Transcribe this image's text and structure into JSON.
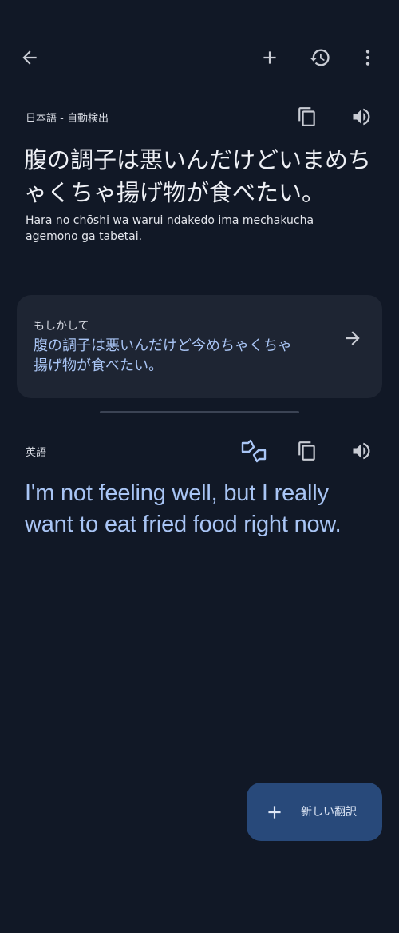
{
  "toolbar": {
    "back_icon": "arrow-back-icon",
    "add_icon": "plus-icon",
    "history_icon": "history-icon",
    "more_icon": "more-vert-icon"
  },
  "source": {
    "language_label": "日本語 - 自動検出",
    "text": "腹の調子は悪いんだけどいまめちゃくちゃ揚げ物が食べたい。",
    "transliteration": "Hara no chōshi wa warui ndakedo ima mechakucha agemono ga tabetai.",
    "copy_icon": "copy-icon",
    "speak_icon": "volume-icon"
  },
  "suggestion": {
    "title": "もしかして",
    "text": "腹の調子は悪いんだけど今めちゃくちゃ揚げ物が食べたい。",
    "arrow_icon": "arrow-forward-icon"
  },
  "target": {
    "language_label": "英語",
    "text": "I'm not feeling well, but I really want to eat fried food right now.",
    "feedback_icon": "rate-translation-icon",
    "copy_icon": "copy-icon",
    "speak_icon": "volume-icon"
  },
  "fab": {
    "label": "新しい翻訳",
    "icon": "plus-icon"
  },
  "colors": {
    "background": "#111826",
    "card": "#1e2533",
    "accent_text": "#a9c5f5",
    "fab": "#28497a"
  }
}
